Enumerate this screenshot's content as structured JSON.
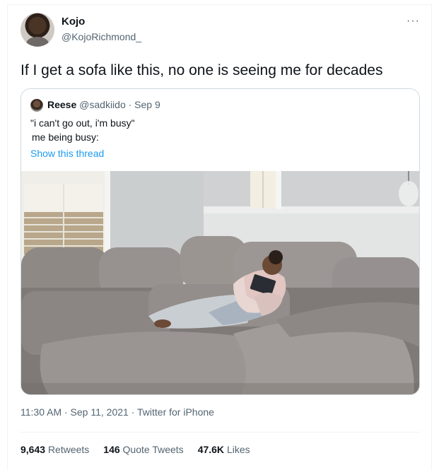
{
  "tweet": {
    "author_name": "Kojo",
    "author_handle": "@KojoRichmond_",
    "more_label": "···",
    "text": "If I get a sofa like this, no one is seeing me for decades",
    "timestamp": "11:30 AM · Sep 11, 2021",
    "separator": " · ",
    "source": "Twitter for iPhone"
  },
  "quote": {
    "author_name": "Reese",
    "author_handle": "@sadkiido",
    "date": "· Sep 9",
    "line1": "\"i can't go out, i'm busy\"",
    "line2": "me being busy:",
    "show_thread": "Show this thread"
  },
  "stats": {
    "retweets_count": "9,643",
    "retweets_label": "Retweets",
    "quotes_count": "146",
    "quotes_label": "Quote Tweets",
    "likes_count": "47.6K",
    "likes_label": "Likes"
  },
  "icons": {
    "more": "more-horizontal-icon"
  }
}
